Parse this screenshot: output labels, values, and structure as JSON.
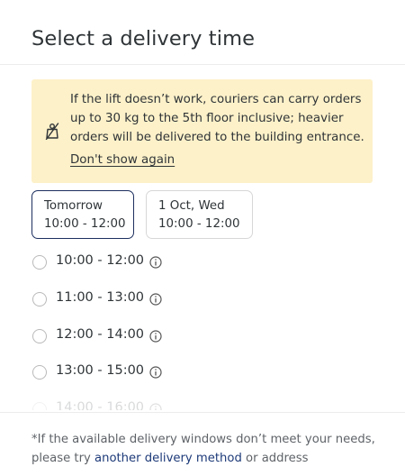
{
  "header": {
    "title": "Select a delivery time"
  },
  "notice": {
    "icon": "weight-off-icon",
    "text": "If the lift doesn’t work, couriers can carry orders up to 30 kg to the 5th floor inclusive; heavier orders will be delivered to the building entrance.",
    "dismiss_label": "Don't show again",
    "background": "#fdf1c9"
  },
  "date_tabs": [
    {
      "day": "Tomorrow",
      "time": "10:00 - 12:00",
      "selected": true
    },
    {
      "day": "1 Oct, Wed",
      "time": "10:00 - 12:00",
      "selected": false
    }
  ],
  "time_slots": [
    {
      "label": "10:00 - 12:00",
      "selected": false
    },
    {
      "label": "11:00 - 13:00",
      "selected": false
    },
    {
      "label": "12:00 - 14:00",
      "selected": false
    },
    {
      "label": "13:00 - 15:00",
      "selected": false
    },
    {
      "label": "14:00 - 16:00",
      "selected": false
    }
  ],
  "footer": {
    "text_before": "*If the available delivery windows don’t meet your needs, please try ",
    "link_label": "another delivery method",
    "text_after": " or address"
  },
  "colors": {
    "accent": "#1d2f5e",
    "link": "#1d3a78"
  }
}
